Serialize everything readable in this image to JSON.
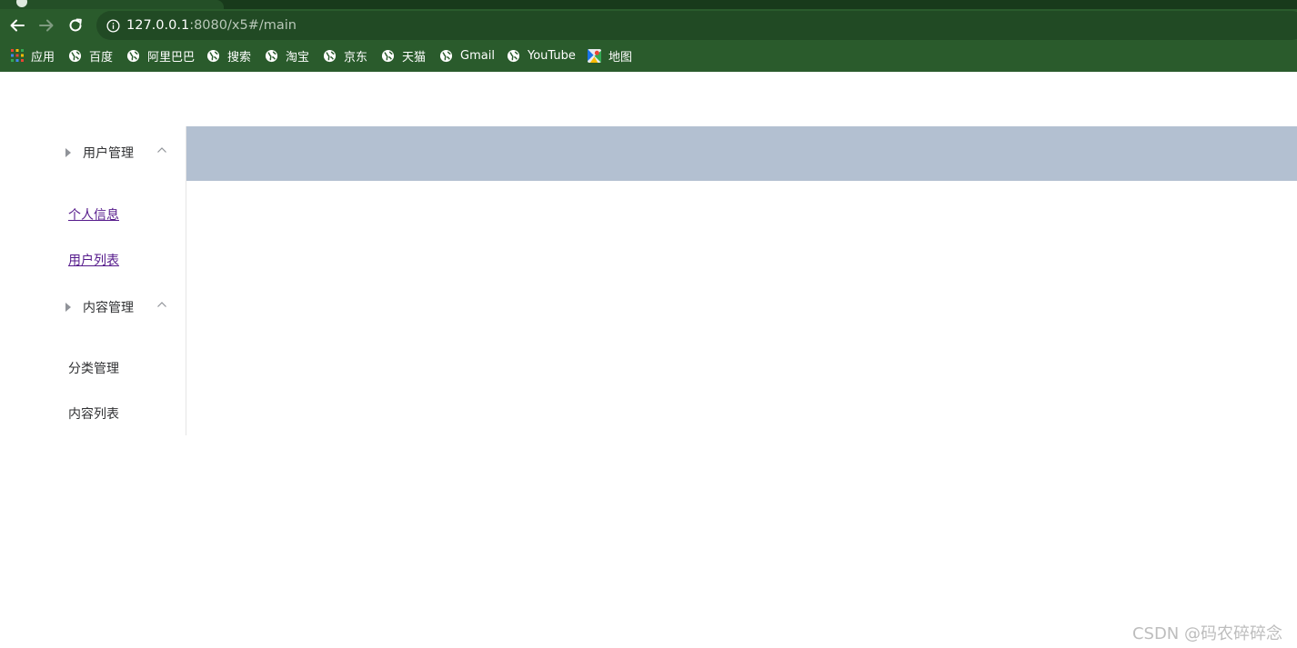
{
  "browser": {
    "url_host": "127.0.0.1",
    "url_rest": ":8080/x5#/main",
    "bookmarks": [
      {
        "label": "应用",
        "icon": "apps-grid-icon"
      },
      {
        "label": "百度",
        "icon": "globe-icon"
      },
      {
        "label": "阿里巴巴",
        "icon": "globe-icon"
      },
      {
        "label": "搜索",
        "icon": "globe-icon"
      },
      {
        "label": "淘宝",
        "icon": "globe-icon"
      },
      {
        "label": "京东",
        "icon": "globe-icon"
      },
      {
        "label": "天猫",
        "icon": "globe-icon"
      },
      {
        "label": "Gmail",
        "icon": "globe-icon"
      },
      {
        "label": "YouTube",
        "icon": "globe-icon"
      },
      {
        "label": "地图",
        "icon": "maps-icon"
      }
    ]
  },
  "sidebar": {
    "groups": [
      {
        "title": "用户管理",
        "items": [
          {
            "label": "个人信息",
            "style": "link"
          },
          {
            "label": "用户列表",
            "style": "link"
          }
        ]
      },
      {
        "title": "内容管理",
        "items": [
          {
            "label": "分类管理",
            "style": "plain"
          },
          {
            "label": "内容列表",
            "style": "plain"
          }
        ]
      }
    ]
  },
  "header": {
    "background": "#b3c0d1"
  },
  "watermark": {
    "text": "CSDN @码农碎碎念"
  },
  "colors": {
    "chrome": "#2a5b2c",
    "link_visited": "#551a8b",
    "text": "#303133"
  }
}
